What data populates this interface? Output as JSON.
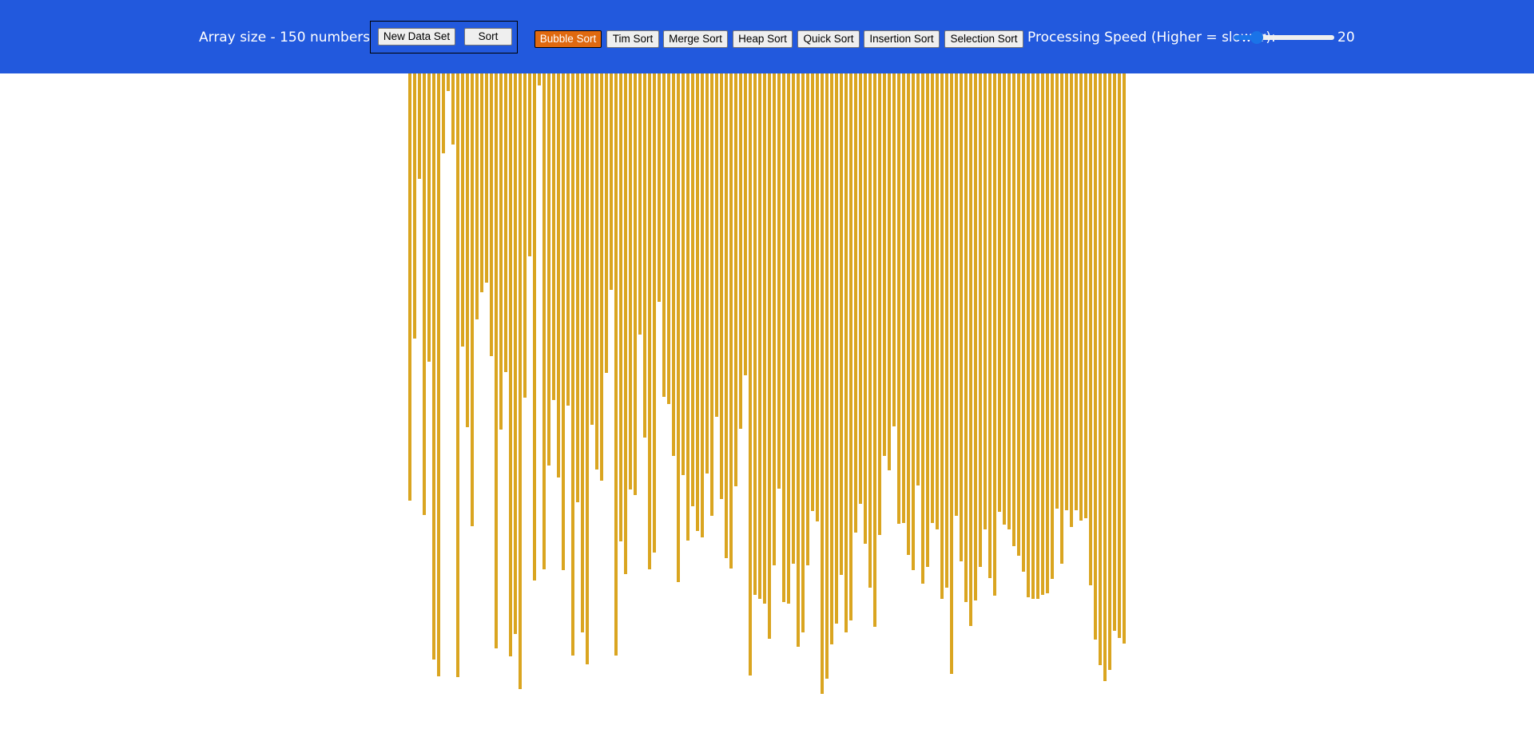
{
  "header": {
    "array_size_text": "Array size - 150 numbers",
    "new_data_label": "New Data Set",
    "sort_label": "Sort",
    "algorithms": [
      {
        "label": "Bubble Sort",
        "active": true
      },
      {
        "label": "Tim Sort",
        "active": false
      },
      {
        "label": "Merge Sort",
        "active": false
      },
      {
        "label": "Heap Sort",
        "active": false
      },
      {
        "label": "Quick Sort",
        "active": false
      },
      {
        "label": "Insertion Sort",
        "active": false
      },
      {
        "label": "Selection Sort",
        "active": false
      }
    ],
    "speed_label": "Processing Speed (Higher = slower):",
    "speed_value": "20",
    "speed_fraction": 0.19
  },
  "colors": {
    "header_bg": "#2259dd",
    "bar": "#daa520",
    "active_button": "#e0690f"
  },
  "array_values": [
    535,
    332,
    132,
    553,
    361,
    734,
    755,
    100,
    22,
    89,
    756,
    342,
    443,
    567,
    308,
    274,
    262,
    354,
    720,
    446,
    374,
    730,
    702,
    771,
    406,
    229,
    635,
    15,
    621,
    491,
    409,
    506,
    622,
    416,
    729,
    537,
    700,
    740,
    440,
    496,
    510,
    375,
    271,
    729,
    586,
    627,
    521,
    528,
    327,
    456,
    621,
    600,
    286,
    405,
    414,
    479,
    637,
    503,
    585,
    542,
    573,
    581,
    501,
    554,
    430,
    533,
    607,
    620,
    517,
    445,
    378,
    754,
    653,
    658,
    664,
    708,
    616,
    520,
    662,
    664,
    614,
    718,
    700,
    616,
    548,
    561,
    777,
    758,
    715,
    689,
    628,
    700,
    685,
    575,
    539,
    589,
    644,
    693,
    578,
    479,
    497,
    442,
    564,
    563,
    603,
    622,
    516,
    639,
    618,
    563,
    571,
    658,
    644,
    752,
    554,
    611,
    662,
    692,
    660,
    618,
    571,
    632,
    654,
    549,
    565,
    571,
    592,
    604,
    624,
    656,
    658,
    658,
    653,
    651,
    633,
    545,
    614,
    547,
    568,
    547,
    560,
    557,
    641,
    709,
    741,
    761,
    747,
    698,
    707,
    714
  ]
}
